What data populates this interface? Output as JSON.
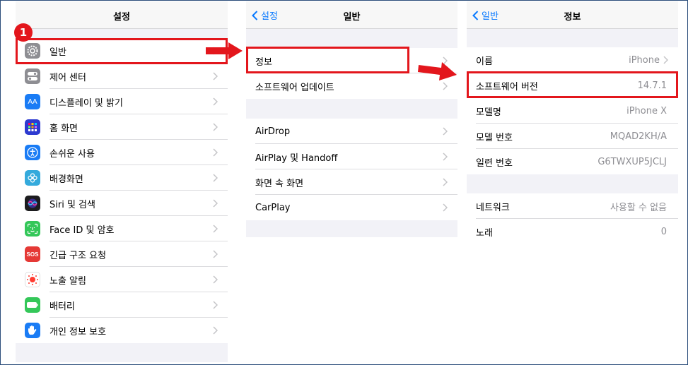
{
  "step_badge": "1",
  "panel1": {
    "title": "설정",
    "items": [
      {
        "label": "일반",
        "icon": "gear-icon",
        "color": "#8e8e93"
      },
      {
        "label": "제어 센터",
        "icon": "control-center-icon",
        "color": "#8e8e93"
      },
      {
        "label": "디스플레이 및 밝기",
        "icon": "display-aa-icon",
        "color": "#1a7cf5",
        "icon_text": "AA"
      },
      {
        "label": "홈 화면",
        "icon": "home-screen-icon",
        "color": "#2d3ad0"
      },
      {
        "label": "손쉬운 사용",
        "icon": "accessibility-icon",
        "color": "#1a7cf5"
      },
      {
        "label": "배경화면",
        "icon": "wallpaper-flower-icon",
        "color": "#34aadc"
      },
      {
        "label": "Siri 및 검색",
        "icon": "siri-icon",
        "color": "#1c1c1e"
      },
      {
        "label": "Face ID 및 암호",
        "icon": "face-id-icon",
        "color": "#34c759"
      },
      {
        "label": "긴급 구조 요청",
        "icon": "sos-icon",
        "color": "#e53935",
        "icon_text": "SOS"
      },
      {
        "label": "노출 알림",
        "icon": "exposure-notification-icon",
        "color": "#ffffff"
      },
      {
        "label": "배터리",
        "icon": "battery-icon",
        "color": "#34c759"
      },
      {
        "label": "개인 정보 보호",
        "icon": "privacy-hand-icon",
        "color": "#1a7cf5"
      }
    ]
  },
  "panel2": {
    "back_label": "설정",
    "title": "일반",
    "group1": [
      "정보",
      "소프트웨어 업데이트"
    ],
    "group2": [
      "AirDrop",
      "AirPlay 및 Handoff",
      "화면 속 화면",
      "CarPlay"
    ]
  },
  "panel3": {
    "back_label": "일반",
    "title": "정보",
    "group1": [
      {
        "label": "이름",
        "value": "iPhone"
      },
      {
        "label": "소프트웨어 버전",
        "value": "14.7.1"
      },
      {
        "label": "모델명",
        "value": "iPhone X"
      },
      {
        "label": "모델 번호",
        "value": "MQAD2KH/A"
      },
      {
        "label": "일련 번호",
        "value": "G6TWXUP5JCLJ"
      }
    ],
    "group2": [
      {
        "label": "네트워크",
        "value": "사용할 수 없음"
      },
      {
        "label": "노래",
        "value": "0"
      }
    ]
  },
  "accent_color": "#e3161c",
  "link_color": "#0a7aff"
}
